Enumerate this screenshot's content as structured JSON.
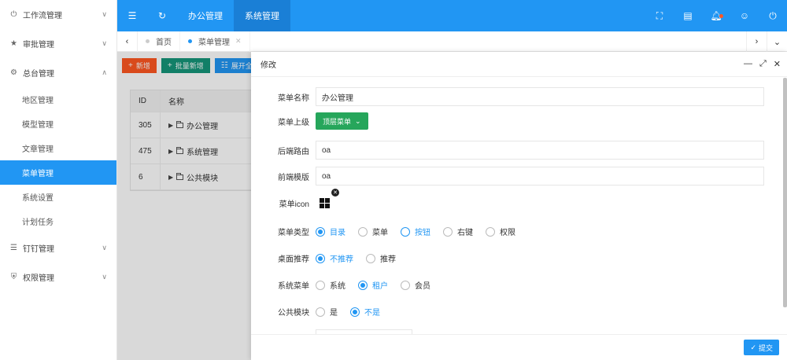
{
  "sidebar": {
    "groups": [
      {
        "label": "工作流管理",
        "icon": "power-icon",
        "arrow": "∨"
      },
      {
        "label": "审批管理",
        "icon": "star-icon",
        "arrow": "∨"
      },
      {
        "label": "总台管理",
        "icon": "gear-icon",
        "arrow": "∧"
      }
    ],
    "subitems": [
      {
        "label": "地区管理"
      },
      {
        "label": "模型管理"
      },
      {
        "label": "文章管理"
      },
      {
        "label": "菜单管理",
        "active": true
      },
      {
        "label": "系统设置"
      },
      {
        "label": "计划任务"
      }
    ],
    "groups2": [
      {
        "label": "钉钉管理",
        "icon": "list-icon",
        "arrow": "∨"
      },
      {
        "label": "权限管理",
        "icon": "shield-icon",
        "arrow": "∨"
      }
    ]
  },
  "header": {
    "nav": [
      "办公管理",
      "系统管理"
    ],
    "active_nav": "系统管理"
  },
  "tabs": [
    {
      "label": "首页",
      "active": false
    },
    {
      "label": "菜单管理",
      "active": true,
      "close": "✕"
    }
  ],
  "toolbar": {
    "add_label": "新增",
    "batch_label": "批量新增",
    "expand_label": "展开全部",
    "colors": {
      "add": "#ff5722",
      "batch": "#16967a",
      "expand": "#2196f3"
    }
  },
  "table": {
    "headers": [
      "ID",
      "名称"
    ],
    "rows": [
      {
        "id": "305",
        "name": "办公管理"
      },
      {
        "id": "475",
        "name": "系统管理"
      },
      {
        "id": "6",
        "name": "公共模块"
      }
    ]
  },
  "modal": {
    "title": "修改",
    "fields": {
      "name_label": "菜单名称",
      "name_value": "办公管理",
      "parent_label": "菜单上级",
      "parent_button": "顶层菜单",
      "backend_label": "后端路由",
      "backend_value": "oa",
      "frontend_label": "前端模版",
      "frontend_value": "oa",
      "icon_label": "菜单icon",
      "icon_name": "windows-icon",
      "type_label": "菜单类型",
      "type_options": [
        "目录",
        "菜单",
        "按钮",
        "右键",
        "权限"
      ],
      "type_selected": "目录",
      "desktop_label": "桌面推荐",
      "desktop_options": [
        "不推荐",
        "推荐"
      ],
      "desktop_selected": "不推荐",
      "system_label": "系统菜单",
      "system_options": [
        "系统",
        "租户",
        "会员"
      ],
      "system_selected": "租户",
      "public_label": "公共模块",
      "public_options": [
        "是",
        "不是"
      ],
      "public_selected": "不是"
    },
    "submit_label": "提交"
  },
  "colors": {
    "primary": "#2196f3",
    "green": "#26a65b",
    "accent": "#ff5722"
  }
}
